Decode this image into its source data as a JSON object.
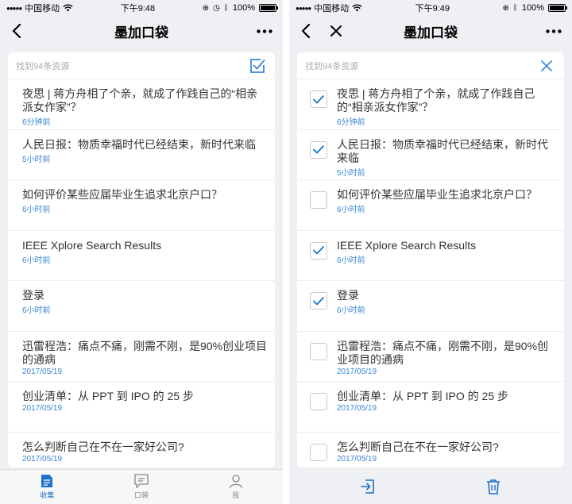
{
  "left_screen": {
    "status": {
      "carrier": "中国移动",
      "time": "下午9:48",
      "battery": "100%"
    },
    "nav": {
      "title": "墨加口袋"
    },
    "card": {
      "count_label": "找到94条资源"
    },
    "items": [
      {
        "title": "夜思 | 蒋方舟相了个亲，就成了作践自己的“相亲派女作家”？",
        "time": "6分钟前"
      },
      {
        "title": "人民日报：物质幸福时代已经结束，新时代来临",
        "time": "5小时前"
      },
      {
        "title": "如何评价某些应届毕业生追求北京户口？",
        "time": "6小时前"
      },
      {
        "title": "IEEE Xplore Search Results",
        "time": "6小时前"
      },
      {
        "title": "登录",
        "time": "6小时前"
      },
      {
        "title": "迅雷程浩：痛点不痛，刚需不刚，是90%创业项目的通病",
        "time": "2017/05/19"
      },
      {
        "title": "创业清单：从 PPT 到 IPO 的 25 步",
        "time": "2017/05/19"
      },
      {
        "title": "怎么判断自己在不在一家好公司?",
        "time": "2017/05/19"
      }
    ],
    "tabs": [
      {
        "label": "收集",
        "icon": "document-icon",
        "active": true
      },
      {
        "label": "口袋",
        "icon": "message-icon",
        "active": false
      },
      {
        "label": "我",
        "icon": "user-icon",
        "active": false
      }
    ]
  },
  "right_screen": {
    "status": {
      "carrier": "中国移动",
      "time": "下午9:49",
      "battery": "100%"
    },
    "nav": {
      "title": "墨加口袋"
    },
    "card": {
      "count_label": "找到94条资源"
    },
    "items": [
      {
        "title": "夜思 | 蒋方舟相了个亲，就成了作践自己的“相亲派女作家”？",
        "time": "6分钟前",
        "checked": true
      },
      {
        "title": "人民日报：物质幸福时代已经结束，新时代来临",
        "time": "5小时前",
        "checked": true
      },
      {
        "title": "如何评价某些应届毕业生追求北京户口？",
        "time": "6小时前",
        "checked": false
      },
      {
        "title": "IEEE Xplore Search Results",
        "time": "6小时前",
        "checked": true
      },
      {
        "title": "登录",
        "time": "6小时前",
        "checked": true
      },
      {
        "title": "迅雷程浩：痛点不痛，刚需不刚，是90%创业项目的通病",
        "time": "2017/05/19",
        "checked": false
      },
      {
        "title": "创业清单：从 PPT 到 IPO 的 25 步",
        "time": "2017/05/19",
        "checked": false
      },
      {
        "title": "怎么判断自己在不在一家好公司?",
        "time": "2017/05/19",
        "checked": false
      }
    ],
    "actions": [
      {
        "icon": "move-to-icon"
      },
      {
        "icon": "trash-icon"
      }
    ]
  },
  "colors": {
    "accent": "#1a73c8",
    "time_text": "#3a86d6",
    "background": "#eef0f3"
  }
}
